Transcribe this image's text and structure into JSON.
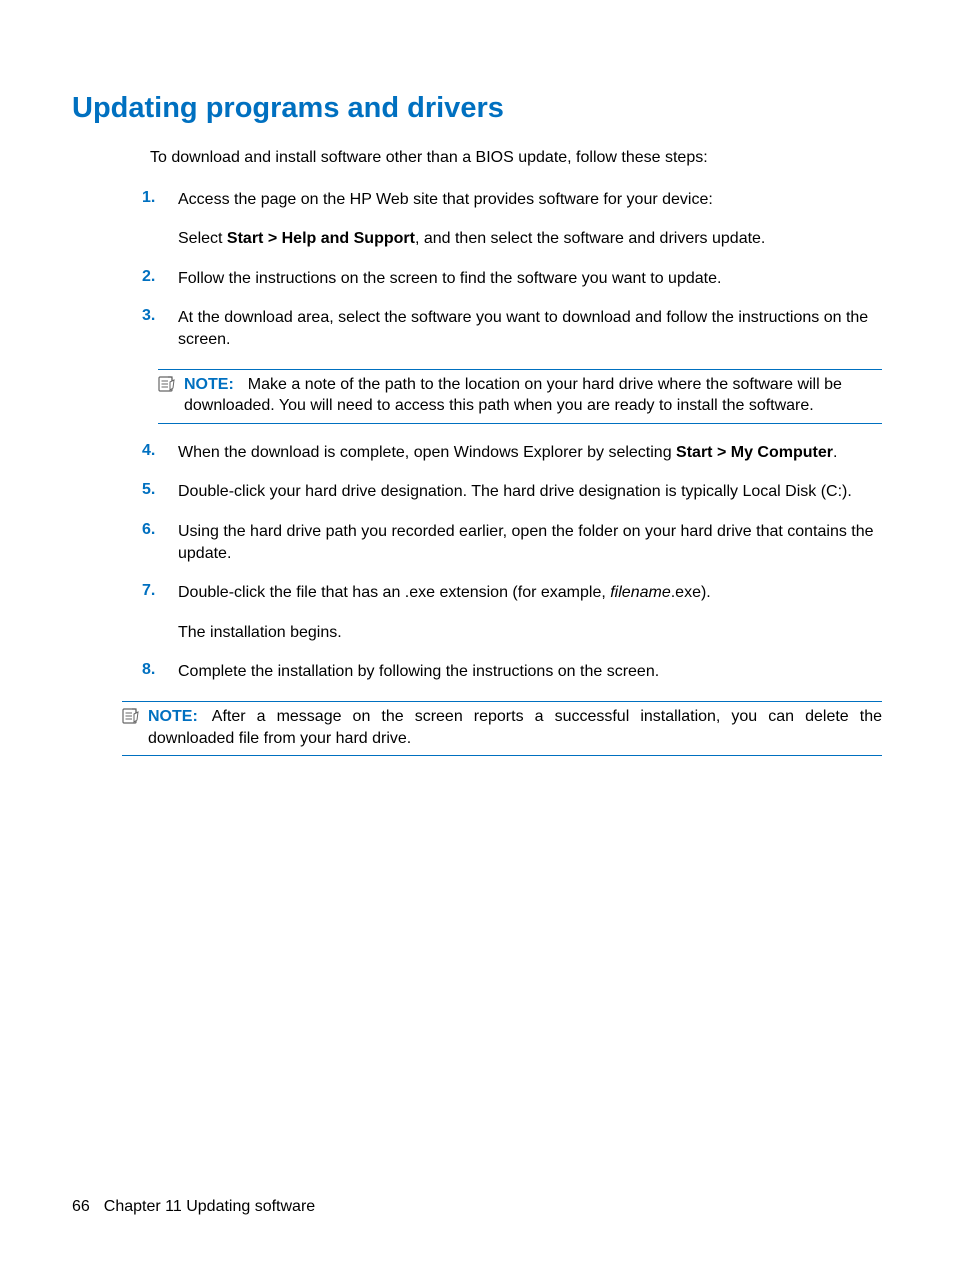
{
  "title": "Updating programs and drivers",
  "intro": "To download and install software other than a BIOS update, follow these steps:",
  "steps": {
    "s1": {
      "n": "1.",
      "p1": "Access the page on the HP Web site that provides software for your device:",
      "p2a": "Select ",
      "p2b": "Start > Help and Support",
      "p2c": ", and then select the software and drivers update."
    },
    "s2": {
      "n": "2.",
      "p1": "Follow the instructions on the screen to find the software you want to update."
    },
    "s3": {
      "n": "3.",
      "p1": "At the download area, select the software you want to download and follow the instructions on the screen."
    },
    "note1": {
      "label": "NOTE:",
      "text": "Make a note of the path to the location on your hard drive where the software will be downloaded. You will need to access this path when you are ready to install the software."
    },
    "s4": {
      "n": "4.",
      "p1a": "When the download is complete, open Windows Explorer by selecting ",
      "p1b": "Start > My Computer",
      "p1c": "."
    },
    "s5": {
      "n": "5.",
      "p1": "Double-click your hard drive designation. The hard drive designation is typically Local Disk (C:)."
    },
    "s6": {
      "n": "6.",
      "p1": "Using the hard drive path you recorded earlier, open the folder on your hard drive that contains the update."
    },
    "s7": {
      "n": "7.",
      "p1a": "Double-click the file that has an .exe extension (for example, ",
      "p1b": "filename",
      "p1c": ".exe).",
      "p2": "The installation begins."
    },
    "s8": {
      "n": "8.",
      "p1": "Complete the installation by following the instructions on the screen."
    },
    "note2": {
      "label": "NOTE:",
      "text": "After a message on the screen reports a successful installation, you can delete the downloaded file from your hard drive."
    }
  },
  "footer": {
    "page": "66",
    "chapter": "Chapter 11   Updating software"
  }
}
